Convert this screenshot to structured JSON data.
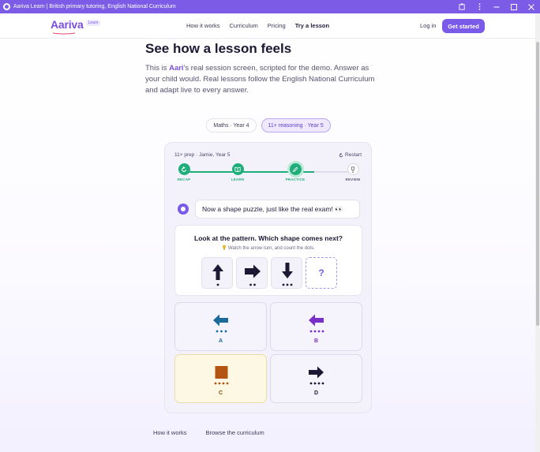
{
  "window": {
    "title": "Aariva Learn | British primary tutoring, English National Curriculum"
  },
  "nav": {
    "logo": "Aariva",
    "logo_badge": "Learn",
    "links": [
      "How it works",
      "Curriculum",
      "Pricing",
      "Try a lesson"
    ],
    "active_link": "Try a lesson",
    "login": "Log in",
    "cta": "Get started"
  },
  "hero": {
    "title": "See how a lesson feels",
    "desc_before": "This is ",
    "tutor_name": "Aari",
    "desc_after": "'s real session screen, scripted for the demo. Answer as your child would. Real lessons follow the English National Curriculum and adapt live to every answer."
  },
  "subject_pills": [
    {
      "label": "Maths · Year 4",
      "active": false
    },
    {
      "label": "11+ reasoning · Year 5",
      "active": true
    }
  ],
  "lesson": {
    "header": "11+ prep · Jamie, Year 5",
    "restart": "Restart",
    "steps": [
      {
        "label": "RECAP",
        "state": "done"
      },
      {
        "label": "LEARN",
        "state": "done"
      },
      {
        "label": "PRACTICE",
        "state": "current"
      },
      {
        "label": "REVIEW",
        "state": "todo"
      }
    ],
    "progress_fraction": 0.78,
    "tutor_message": "Now a shape puzzle, just like the real exam! 👀",
    "question": "Look at the pattern. Which shape comes next?",
    "hint": "Watch the arrow turn, and count the dots.",
    "pattern": [
      {
        "arrow": "up",
        "dots": 1
      },
      {
        "arrow": "right",
        "dots": 2
      },
      {
        "arrow": "down",
        "dots": 3
      },
      {
        "arrow": "unknown",
        "label": "?"
      }
    ],
    "options": [
      {
        "letter": "A",
        "shape": "arrow-left",
        "dots": 3,
        "color": "#1a6b9a"
      },
      {
        "letter": "B",
        "shape": "arrow-left",
        "dots": 4,
        "color": "#7b2fc9"
      },
      {
        "letter": "C",
        "shape": "square",
        "dots": 4,
        "color": "#b3540f",
        "selected": true
      },
      {
        "letter": "D",
        "shape": "arrow-right",
        "dots": 4,
        "color": "#1a1833"
      }
    ]
  },
  "footer_links": [
    "How it works",
    "Browse the curriculum"
  ],
  "colors": {
    "brand": "#7a5ae9",
    "success": "#1fae7a",
    "title_bar": "#7c5ce6"
  }
}
